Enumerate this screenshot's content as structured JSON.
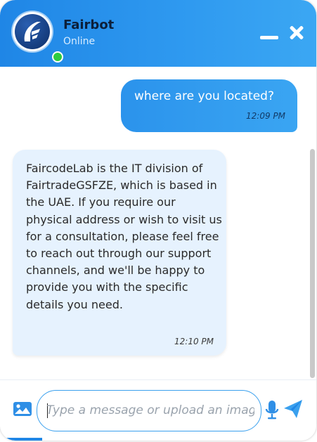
{
  "header": {
    "title": "Fairbot",
    "status": "Online",
    "accent_color": "#1f86e6"
  },
  "messages": [
    {
      "role": "user",
      "text": "where are you located?",
      "time": "12:09 PM"
    },
    {
      "role": "bot",
      "text": "FaircodeLab is the IT division of FairtradeGSFZE, which is based in the UAE. If you require our physical address or wish to visit us for a consultation, please feel free to reach out through our support channels, and we'll be happy to provide you with the specific details you need.",
      "time": "12:10 PM"
    }
  ],
  "composer": {
    "placeholder": "Type a message or upload an image",
    "value": ""
  },
  "icons": {
    "upload": "image-icon",
    "voice": "microphone-icon",
    "send": "send-icon",
    "minimize": "minimize-icon",
    "close": "close-icon"
  }
}
